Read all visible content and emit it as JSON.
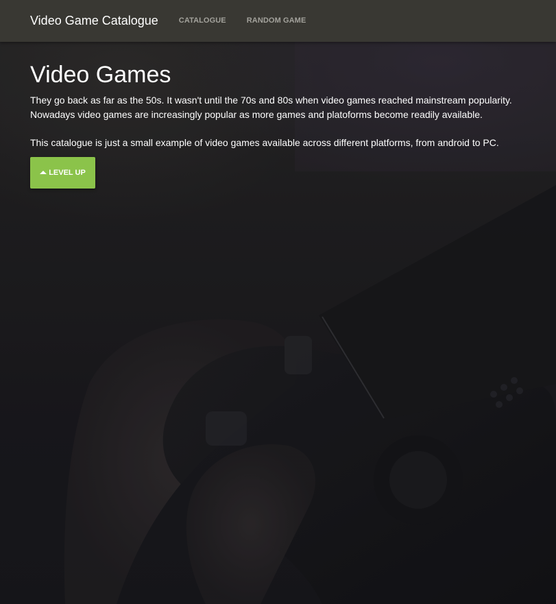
{
  "navbar": {
    "brand": "Video Game Catalogue",
    "links": [
      {
        "label": "CATALOGUE"
      },
      {
        "label": "RANDOM GAME"
      }
    ]
  },
  "hero": {
    "title": "Video Games",
    "paragraph_1": "They go back as far as the 50s. It wasn't until the 70s and 80s when video games reached mainstream popularity. Nowadays video games are increasingly popular as more games and platoforms become readily available.",
    "paragraph_2": "This catalogue is just a small example of video games available across different platforms, from android to PC.",
    "button_label": "LEVEL UP",
    "button_icon": "arrow-up-icon"
  },
  "colors": {
    "navbar_bg": "#3a3934",
    "accent_button": "#8bc34a",
    "nav_link": "#a3a29c"
  }
}
